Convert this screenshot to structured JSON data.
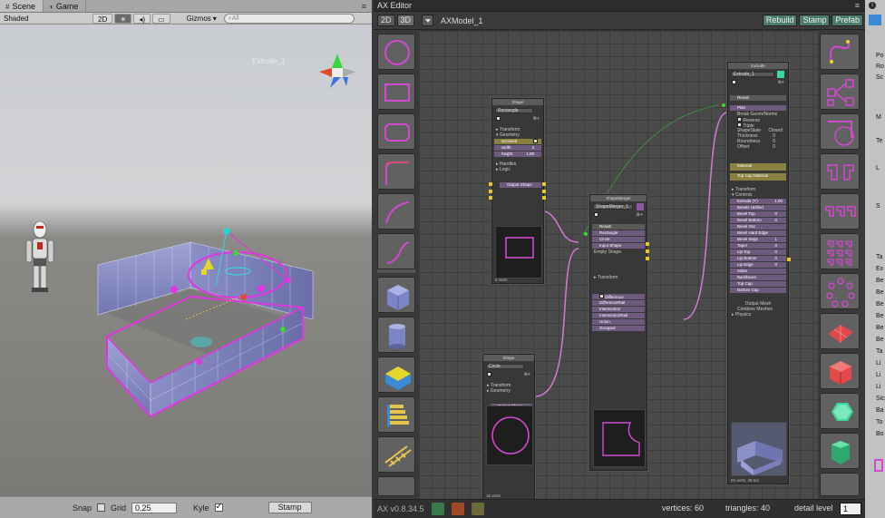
{
  "scene": {
    "tabs": [
      {
        "label": "Scene",
        "icon": "grid-icon"
      },
      {
        "label": "Game",
        "icon": "pacman-icon"
      }
    ],
    "toolbar": {
      "shading_mode": "Shaded",
      "mode_2d": "2D",
      "gizmos": "Gizmos",
      "search_placeholder": "All"
    },
    "object_label": "Extrude_1",
    "snapbar": {
      "snap_label": "Snap",
      "grid_label": "Grid",
      "grid_value": "0.25",
      "kyle_label": "Kyle",
      "stamp_label": "Stamp"
    }
  },
  "ax": {
    "title": "AX Editor",
    "btn_2d": "2D",
    "btn_3d": "3D",
    "model_name": "AXModel_1",
    "rebuild": "Rebuild",
    "stamp": "Stamp",
    "prefab": "Prefab",
    "nodes": {
      "shape_rect": {
        "title": "Shape",
        "name": "Rectangle",
        "transform": "Transform",
        "geometry": "Geometry",
        "p_closed": "isClosed",
        "p_width": "width",
        "p_width_val": "3",
        "p_height": "height",
        "p_height_val": "1.99",
        "handles": "Handles",
        "logic": "Logic",
        "output": "Output Shape",
        "verts": "5 verts"
      },
      "shape_circle": {
        "title": "Shape",
        "name": "Circle",
        "transform": "Transform",
        "geometry": "Geometry",
        "output": "Output Shape",
        "verts": "16 verts"
      },
      "merger": {
        "title": "ShapeMerger",
        "name": "ShapeMerger_1",
        "result": "Result",
        "in1": "Rectangle",
        "in2": "Circle",
        "in3": "Input Shape",
        "empty": "Empty Shape",
        "transform": "Transform",
        "outputs": [
          "Difference",
          "DifferenceRail",
          "Intersection",
          "IntersectionRail",
          "Union",
          "Grouped"
        ]
      },
      "extrude": {
        "title": "Extrude",
        "name": "Extrude_1",
        "result": "Result",
        "plan": "Plan",
        "break": "Break Geom/Norms",
        "reverse": "Reverse",
        "triple": "Triple",
        "shape_state": "ShapeState",
        "shape_state_val": "Closed",
        "thickness": "Thickness",
        "roundness": "Roundness",
        "offset": "Offset",
        "material": "Material",
        "topcap": "Top Cap Material",
        "transform": "Transform",
        "controls": "Controls",
        "extrude_y": "Extrude (Y)",
        "extrude_y_val": "1.00",
        "bevels_unified": "Bevels Unified",
        "bevel_top": "Bevel Top",
        "bevel_bottom": "Bevel Bottom",
        "bevel_out": "Bevel Out",
        "bevel_hard_edge": "Bevel Hard Edge",
        "bevel_segs": "Bevel Segs",
        "taper": "Taper",
        "lip_top": "Lip Top",
        "lip_bottom": "Lip Bottom",
        "lip_edge": "Lip Edge",
        "sides": "Sides",
        "backfaces": "Backfaces",
        "top_cap": "Top Cap",
        "bottom_cap": "Bottom Cap",
        "output_mesh": "Output Mesh",
        "combine_meshes": "Combine Meshes",
        "physics": "Physics",
        "zero": "0",
        "one": "1",
        "stats": "50 verts, 48 tris"
      }
    },
    "status": {
      "version": "AX v0.8.34.5",
      "vertices": "vertices: 60",
      "triangles": "triangles: 40",
      "detail_label": "detail level",
      "detail_value": "1"
    }
  },
  "inspector": {
    "lines": [
      "Po",
      "Ro",
      "Sc",
      "M",
      "Te",
      "L",
      "S",
      "Ta",
      "Ex",
      "Be",
      "Be",
      "Be",
      "Be",
      "Be",
      "Be",
      "Ta",
      "Li",
      "Li",
      "Li",
      "Sic",
      "Ba",
      "To",
      "Bo"
    ]
  },
  "colors": {
    "accent_magenta": "#d249d2",
    "node_port_yellow": "#e7c52e",
    "wire_pink": "#d47ad4",
    "ax_bg": "#4a4a4a",
    "stamp_green": "#4d7a6a"
  }
}
